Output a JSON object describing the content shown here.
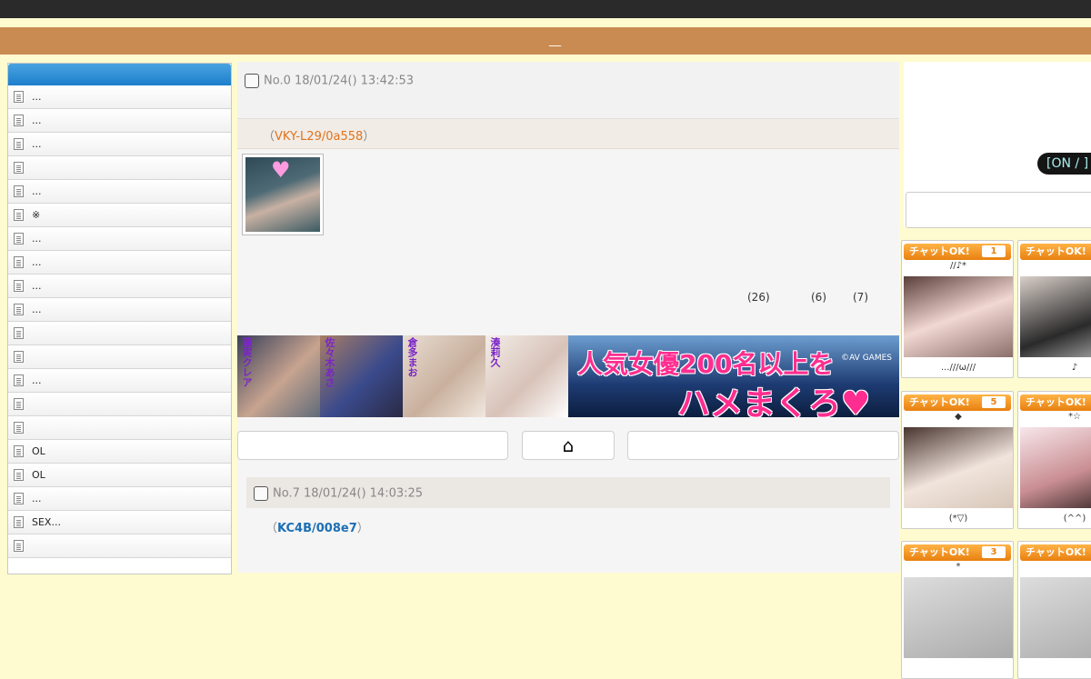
{
  "header": {
    "mark": "__"
  },
  "sidebar": {
    "items": [
      {
        "label": "..."
      },
      {
        "label": "..."
      },
      {
        "label": "..."
      },
      {
        "label": ""
      },
      {
        "label": "..."
      },
      {
        "label": "※"
      },
      {
        "label": "..."
      },
      {
        "label": "..."
      },
      {
        "label": "..."
      },
      {
        "label": "..."
      },
      {
        "label": ""
      },
      {
        "label": ""
      },
      {
        "label": "..."
      },
      {
        "label": ""
      },
      {
        "label": ""
      },
      {
        "label": "OL"
      },
      {
        "label": "OL"
      },
      {
        "label": "..."
      },
      {
        "label": "SEX..."
      },
      {
        "label": ""
      }
    ]
  },
  "post0": {
    "meta": "No.0 18/01/24() 13:42:53",
    "id_open": "（",
    "id": "VKY-L29/0a558",
    "id_close": "）",
    "counts": [
      "(26)",
      "(6)",
      "(7)"
    ]
  },
  "banner": {
    "actresses": [
      "蓮実クレア",
      "佐々木あさ",
      "倉多まお",
      "湊莉久"
    ],
    "line1": "人気女優200名以上を",
    "line2": "ハメまくろ♥",
    "brand": "©AV GAMES"
  },
  "nav": {
    "home_icon": "⌂"
  },
  "post7": {
    "meta": "No.7  18/01/24() 14:03:25",
    "id_open": "（",
    "id": "KC4B/008e7",
    "id_close": "）"
  },
  "right": {
    "toggle": "[ON / ]"
  },
  "cards": [
    {
      "tag": "チャットOK!",
      "num": "1",
      "nick": "//♪*",
      "caption": "...///ω///"
    },
    {
      "tag": "チャットOK!",
      "num": "",
      "nick": "",
      "caption": "♪"
    },
    {
      "tag": "チャットOK!",
      "num": "5",
      "nick": "◆",
      "caption": "(*▽)"
    },
    {
      "tag": "チャットOK!",
      "num": "",
      "nick": "*☆",
      "caption": "(^^)"
    },
    {
      "tag": "チャットOK!",
      "num": "3",
      "nick": "*",
      "caption": ""
    },
    {
      "tag": "チャットOK!",
      "num": "",
      "nick": "",
      "caption": ""
    }
  ]
}
